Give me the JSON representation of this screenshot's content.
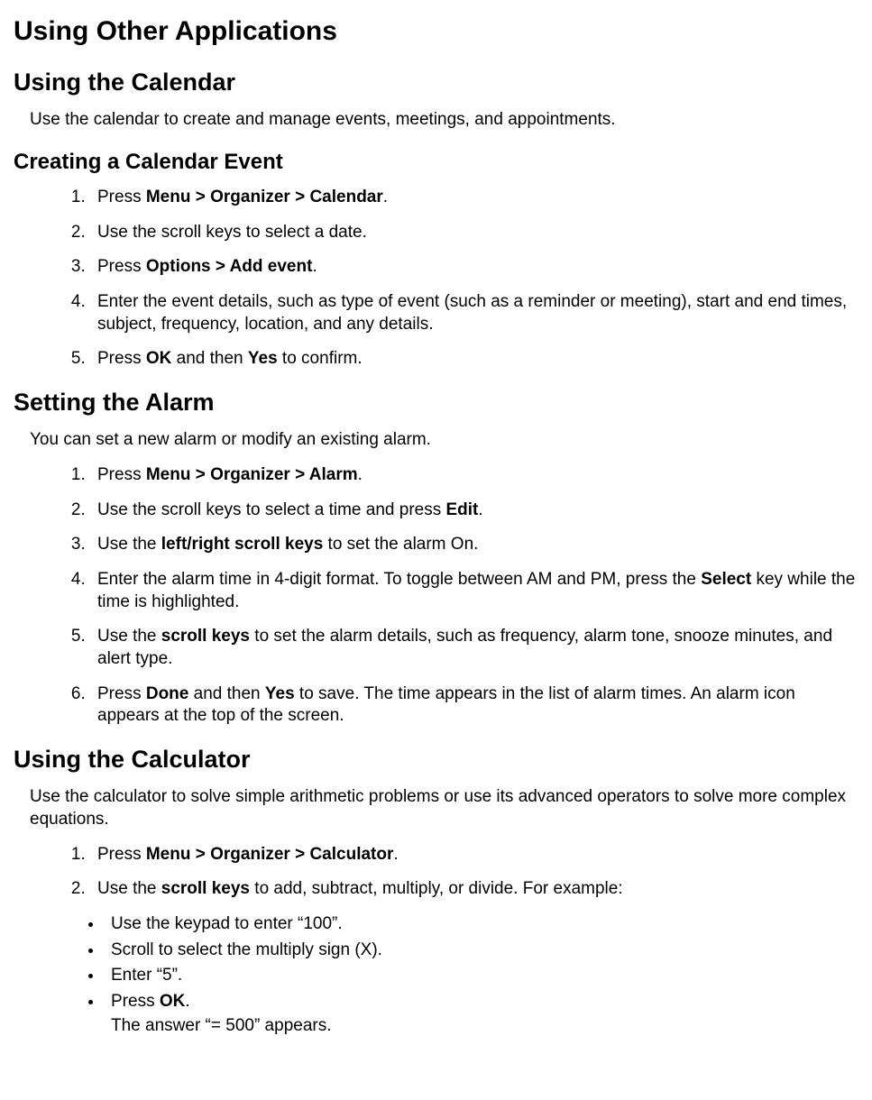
{
  "h1": "Using Other Applications",
  "calendar": {
    "h2": "Using the  Calendar",
    "intro": "Use the calendar to create and manage events, meetings, and appointments.",
    "h3": "Creating a Calendar Event",
    "steps": {
      "s1a": "Press ",
      "s1b": "Menu > Organizer > Calendar",
      "s1c": ".",
      "s2": "Use the scroll keys to select a date.",
      "s3a": "Press ",
      "s3b": "Options > Add event",
      "s3c": ".",
      "s4": "Enter the event details, such as type of event (such as a reminder or meeting), start and end times, subject, frequency, location, and any details.",
      "s5a": "Press ",
      "s5b": "OK",
      "s5c": " and then ",
      "s5d": "Yes",
      "s5e": " to confirm."
    }
  },
  "alarm": {
    "h2": "Setting the  Alarm",
    "intro": "You can set a new alarm or modify an existing alarm.",
    "steps": {
      "s1a": "Press ",
      "s1b": "Menu > Organizer > Alarm",
      "s1c": ".",
      "s2a": "Use the scroll keys to select a time and press ",
      "s2b": "Edit",
      "s2c": ".",
      "s3a": "Use the ",
      "s3b": "left/right scroll keys",
      "s3c": " to set the alarm On.",
      "s4a": "Enter the alarm time in 4-digit format. To toggle between AM and PM, press the ",
      "s4b": "Select",
      "s4c": " key while the time is highlighted.",
      "s5a": "Use the ",
      "s5b": "scroll keys",
      "s5c": " to set the alarm details, such as frequency, alarm tone, snooze minutes, and alert type.",
      "s6a": "Press ",
      "s6b": "Done",
      "s6c": " and then ",
      "s6d": "Yes",
      "s6e": " to save. The time appears in the list of alarm times. An alarm icon appears at the top of the screen."
    }
  },
  "calculator": {
    "h2": "Using the Calculator",
    "intro": "Use the calculator to solve simple arithmetic problems or use its advanced operators to solve more complex equations.",
    "steps": {
      "s1a": "Press ",
      "s1b": "Menu > Organizer > Calculator",
      "s1c": ".",
      "s2a": "Use the ",
      "s2b": "scroll keys",
      "s2c": " to add, subtract, multiply, or divide. For example:"
    },
    "bullets": {
      "b1": "Use the keypad to enter “100”.",
      "b2": "Scroll to select the multiply sign (X).",
      "b3": "Enter “5”.",
      "b4a": "Press ",
      "b4b": "OK",
      "b4c": ".",
      "b4d": "The answer “= 500” appears."
    }
  }
}
